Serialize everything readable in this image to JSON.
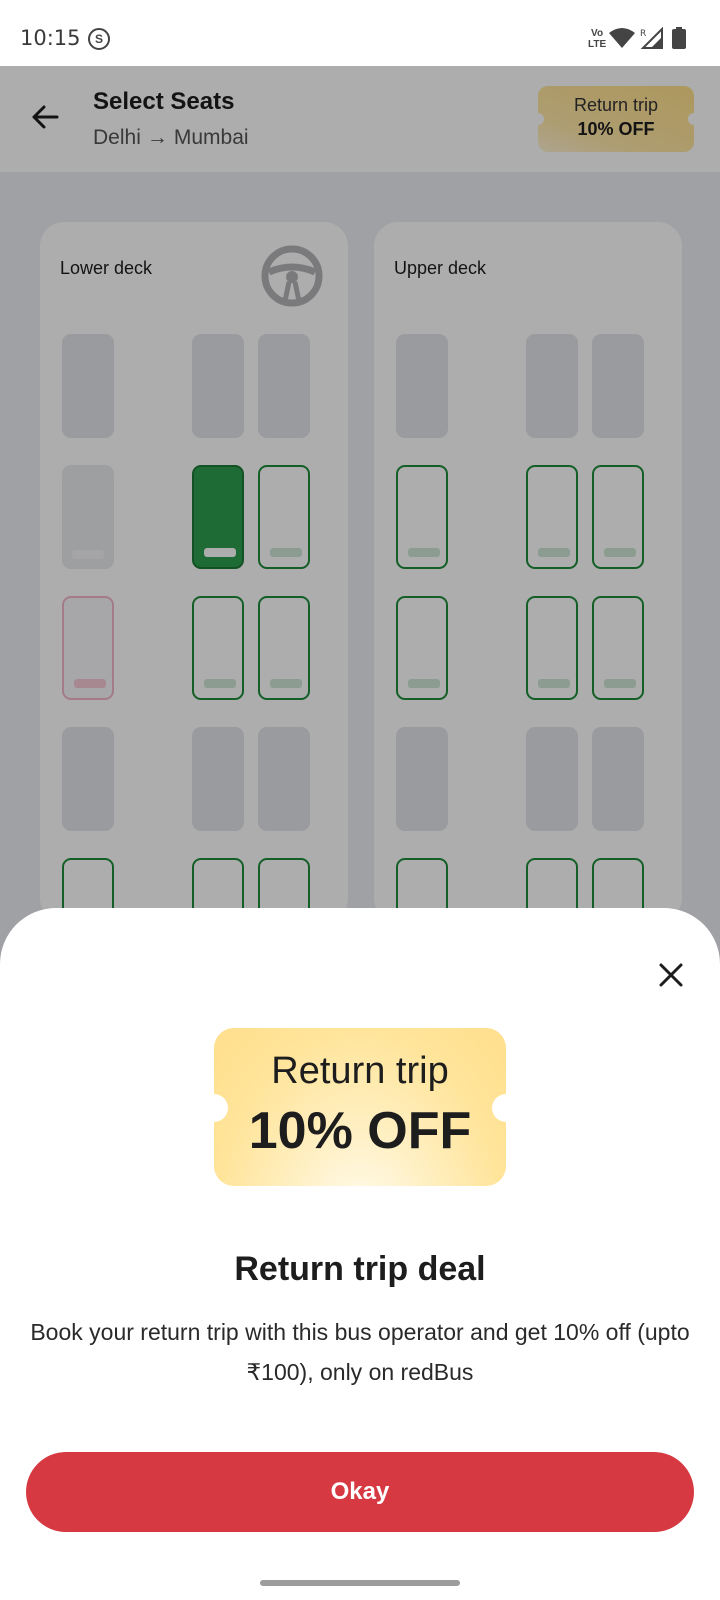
{
  "status_bar": {
    "time": "10:15",
    "sync_icon": "S",
    "volte_line1": "Vo",
    "volte_line2": "LTE",
    "roaming": "R",
    "icons": [
      "sync-icon",
      "volte-icon",
      "wifi-icon",
      "signal-icon",
      "battery-icon"
    ]
  },
  "header": {
    "title": "Select Seats",
    "from": "Delhi",
    "arrow": "→",
    "to": "Mumbai",
    "badge_line1": "Return trip",
    "badge_line2": "10% OFF"
  },
  "decks": {
    "lower_label": "Lower deck",
    "upper_label": "Upper deck"
  },
  "seat_states": {
    "lower": [
      [
        "booked",
        "booked",
        "booked"
      ],
      [
        "unavailable",
        "selected",
        "available"
      ],
      [
        "ladies",
        "available",
        "available"
      ],
      [
        "booked",
        "booked",
        "booked"
      ],
      [
        "available",
        "available",
        "available"
      ]
    ],
    "upper": [
      [
        "booked",
        "booked",
        "booked"
      ],
      [
        "available",
        "available",
        "available"
      ],
      [
        "available",
        "available",
        "available"
      ],
      [
        "booked",
        "booked",
        "booked"
      ],
      [
        "available",
        "available",
        "available"
      ]
    ]
  },
  "sheet": {
    "ticket_line1": "Return trip",
    "ticket_line2": "10% OFF",
    "title": "Return trip deal",
    "description": "Book your return trip with this bus operator and get 10% off (upto ₹100), only on redBus",
    "okay_label": "Okay"
  },
  "colors": {
    "accent_red": "#d63941",
    "seat_available": "#1c8c3a",
    "seat_selected": "#2e9e4e",
    "ticket_gold": "#ffe49a"
  }
}
